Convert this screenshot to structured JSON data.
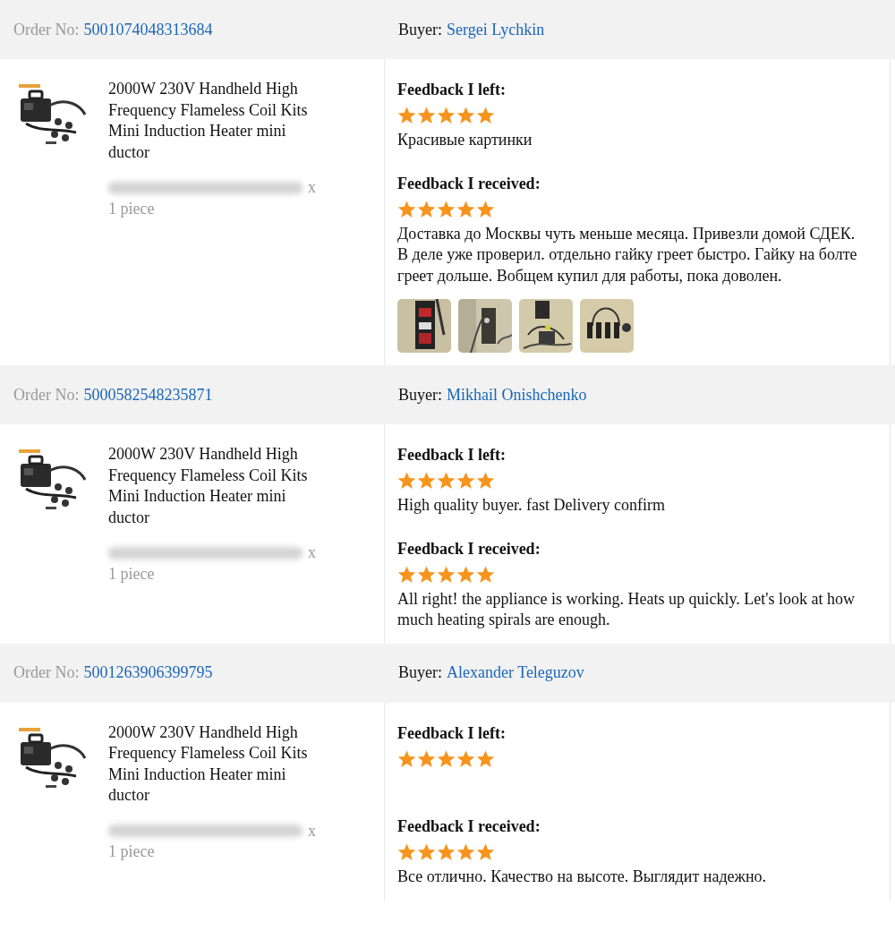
{
  "orders": [
    {
      "order_label": "Order No:",
      "order_no": "5001074048313684",
      "buyer_label": "Buyer:",
      "buyer": "Sergei Lychkin",
      "product": {
        "image": {
          "kind": "picture"
        },
        "title": "2000W 230V Handheld High Frequency Flameless Coil Kits Mini Induction Heater mini ductor",
        "quantity_suffix": "x",
        "quantity": "1 piece"
      },
      "feedback": [
        {
          "heading": "Feedback I left:",
          "stars": 5,
          "comment": "Красивые картинки"
        },
        {
          "heading": "Feedback I received:",
          "stars": 5,
          "comment": "Доставка до Москвы чуть меньше месяца. Привезли домой СДЕК. В деле уже проверил. отдельно гайку греет быстро. Гайку на болте греет дольше. Вобщем купил для работы, пока доволен.",
          "photos": [
            {
              "kind": "picture"
            },
            {
              "kind": "picture"
            },
            {
              "kind": "picture"
            },
            {
              "kind": "picture"
            }
          ]
        }
      ]
    },
    {
      "order_label": "Order No:",
      "order_no": "5000582548235871",
      "buyer_label": "Buyer:",
      "buyer": "Mikhail Onishchenko",
      "product": {
        "image": {
          "kind": "picture"
        },
        "title": "2000W 230V Handheld High Frequency Flameless Coil Kits Mini Induction Heater mini ductor",
        "quantity_suffix": "x",
        "quantity": "1 piece"
      },
      "feedback": [
        {
          "heading": "Feedback I left:",
          "stars": 5,
          "comment": "High quality buyer. fast Delivery confirm"
        },
        {
          "heading": "Feedback I received:",
          "stars": 5,
          "comment": "All right! the appliance is working. Heats up quickly. Let's look at how much heating spirals are enough."
        }
      ]
    },
    {
      "order_label": "Order No:",
      "order_no": "5001263906399795",
      "buyer_label": "Buyer:",
      "buyer": "Alexander Teleguzov",
      "product": {
        "image": {
          "kind": "picture"
        },
        "title": "2000W 230V Handheld High Frequency Flameless Coil Kits Mini Induction Heater mini ductor",
        "quantity_suffix": "x",
        "quantity": "1 piece"
      },
      "feedback": [
        {
          "heading": "Feedback I left:",
          "stars": 5
        },
        {
          "heading": "Feedback I received:",
          "stars": 5,
          "comment": "Все отлично. Качество на высоте. Выглядит надежно."
        }
      ]
    }
  ]
}
